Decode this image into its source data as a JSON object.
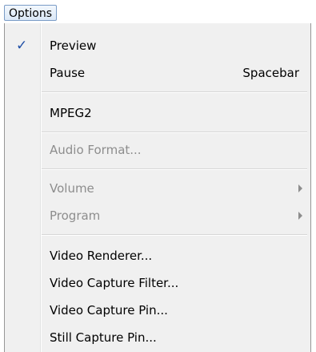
{
  "menubar": {
    "options_label": "Options"
  },
  "menu": {
    "preview_label": "Preview",
    "preview_checked": true,
    "pause_label": "Pause",
    "pause_shortcut": "Spacebar",
    "mpeg2_label": "MPEG2",
    "audio_format_label": "Audio Format...",
    "volume_label": "Volume",
    "program_label": "Program",
    "video_renderer_label": "Video Renderer...",
    "video_capture_filter_label": "Video Capture Filter...",
    "video_capture_pin_label": "Video Capture Pin...",
    "still_capture_pin_label": "Still Capture Pin..."
  },
  "icons": {
    "check": "✓",
    "submenu": "submenu-arrow-icon"
  },
  "colors": {
    "menu_background": "#f0f0f0",
    "disabled_text": "#8d8d8d",
    "check_color": "#1f4fa6",
    "menubar_highlight": "#dbe8f7"
  }
}
